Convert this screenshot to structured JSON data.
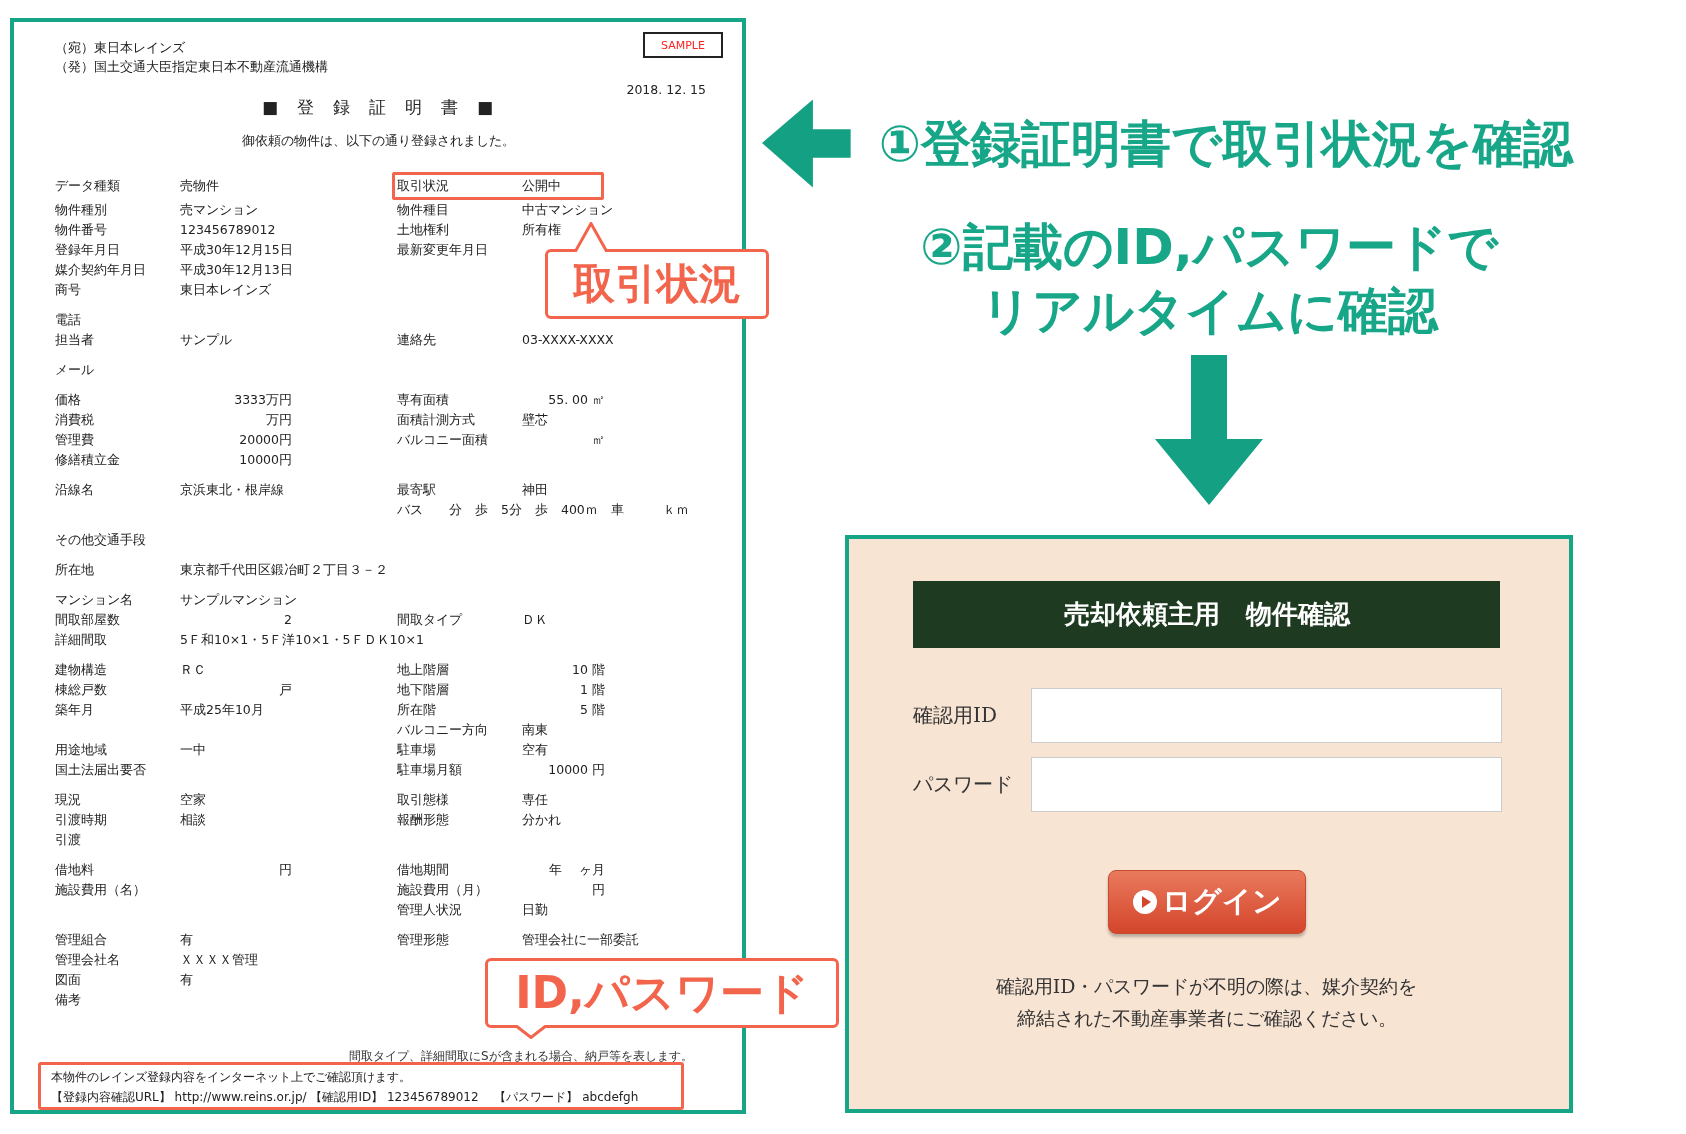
{
  "certificate": {
    "addressee": "（宛）東日本レインズ",
    "sender": "（発）国土交通大臣指定東日本不動産流通機構",
    "stamp": "SAMPLE",
    "date": "2018. 12. 15",
    "title": "■　登　録　証　明　書　■",
    "intro": "御依頼の物件は、以下の通り登録されました。",
    "groups": [
      [
        {
          "left": {
            "label": "データ種類",
            "value": "売物件"
          },
          "right": {
            "label": "取引状況",
            "value": "公開中"
          }
        },
        {
          "left": {
            "label": "物件種別",
            "value": "売マンション"
          },
          "right": {
            "label": "物件種目",
            "value": "中古マンション"
          }
        },
        {
          "left": {
            "label": "物件番号",
            "value": "123456789012"
          },
          "right": {
            "label": "土地権利",
            "value": "所有権"
          }
        },
        {
          "left": {
            "label": "登録年月日",
            "value": "平成30年12月15日"
          },
          "right": {
            "label": "最新変更年月日"
          }
        },
        {
          "left": {
            "label": "媒介契約年月日",
            "value": "平成30年12月13日"
          }
        },
        {
          "left": {
            "label": "商号",
            "value": "東日本レインズ"
          }
        }
      ],
      [
        {
          "left": {
            "label": "電話"
          }
        },
        {
          "left": {
            "label": "担当者",
            "value": "サンプル"
          },
          "right": {
            "label": "連絡先",
            "value": "03-XXXX-XXXX"
          }
        }
      ],
      [
        {
          "left": {
            "label": "メール"
          }
        }
      ],
      [
        {
          "left": {
            "label": "価格",
            "value": "3333万円",
            "kind": "amount"
          },
          "right": {
            "label": "専有面積",
            "value": "55. 00 ㎡",
            "kind": "amount"
          }
        },
        {
          "left": {
            "label": "消費税",
            "value": "万円",
            "kind": "amount"
          },
          "right": {
            "label": "面積計測方式",
            "value": "壁芯"
          }
        },
        {
          "left": {
            "label": "管理費",
            "value": "20000円",
            "kind": "amount"
          },
          "right": {
            "label": "バルコニー面積",
            "value": "㎡",
            "kind": "amount"
          }
        },
        {
          "left": {
            "label": "修繕積立金",
            "value": "10000円",
            "kind": "amount"
          }
        }
      ],
      [
        {
          "left": {
            "label": "沿線名",
            "value": "京浜東北・根岸線"
          },
          "right": {
            "label": "最寄駅",
            "value": "神田"
          }
        },
        {
          "right": {
            "value": "バス　　分　歩　5分　歩　400ｍ　車　　　ｋｍ"
          }
        }
      ],
      [
        {
          "left": {
            "label": "その他交通手段"
          }
        }
      ],
      [
        {
          "left": {
            "label": "所在地",
            "value": "東京都千代田区鍛冶町２丁目３－２"
          }
        }
      ],
      [
        {
          "left": {
            "label": "マンション名",
            "value": "サンプルマンション"
          }
        },
        {
          "left": {
            "label": "間取部屋数",
            "value": "2",
            "kind": "amount"
          },
          "right": {
            "label": "間取タイプ",
            "value": "ＤＫ"
          }
        },
        {
          "left": {
            "label": "詳細間取",
            "value": "5Ｆ和10×1・5Ｆ洋10×1・5ＦＤＫ10×1"
          }
        }
      ],
      [
        {
          "left": {
            "label": "建物構造",
            "value": "ＲＣ"
          },
          "right": {
            "label": "地上階層",
            "value": "10 階",
            "kind": "amount"
          }
        },
        {
          "left": {
            "label": "棟総戸数",
            "value": "戸",
            "kind": "amount"
          },
          "right": {
            "label": "地下階層",
            "value": "1 階",
            "kind": "amount"
          }
        },
        {
          "left": {
            "label": "築年月",
            "value": "平成25年10月"
          },
          "right": {
            "label": "所在階",
            "value": "5 階",
            "kind": "amount"
          }
        },
        {
          "right": {
            "label": "バルコニー方向",
            "value": "南東"
          }
        },
        {
          "left": {
            "label": "用途地域",
            "value": "一中"
          },
          "right": {
            "label": "駐車場",
            "value": "空有"
          }
        },
        {
          "left": {
            "label": "国土法届出要否"
          },
          "right": {
            "label": "駐車場月額",
            "value": "10000 円",
            "kind": "amount"
          }
        }
      ],
      [
        {
          "left": {
            "label": "現況",
            "value": "空家"
          },
          "right": {
            "label": "取引態様",
            "value": "専任"
          }
        },
        {
          "left": {
            "label": "引渡時期",
            "value": "相談"
          },
          "right": {
            "label": "報酬形態",
            "value": "分かれ"
          }
        },
        {
          "left": {
            "label": "引渡"
          }
        }
      ],
      [
        {
          "left": {
            "label": "借地料",
            "value": "円",
            "kind": "amount"
          },
          "right": {
            "label": "借地期間",
            "value": "年　 ヶ月",
            "kind": "amount"
          }
        },
        {
          "left": {
            "label": "施設費用（名）"
          },
          "right": {
            "label": "施設費用（月）",
            "value": "円",
            "kind": "amount"
          }
        },
        {
          "right": {
            "label": "管理人状況",
            "value": "日勤"
          }
        }
      ],
      [
        {
          "left": {
            "label": "管理組合",
            "value": "有"
          },
          "right": {
            "label": "管理形態",
            "value": "管理会社に一部委託"
          }
        },
        {
          "left": {
            "label": "管理会社名",
            "value": "ＸＸＸＸ管理"
          }
        },
        {
          "left": {
            "label": "図面",
            "value": "有"
          }
        },
        {
          "left": {
            "label": "備考"
          }
        }
      ]
    ],
    "note": "間取タイプ、詳細間取にSが含まれる場合、納戸等を表します。",
    "footer": [
      "本物件のレインズ登録内容をインターネット上でご確認頂けます。",
      "【登録内容確認URL】 http://www.reins.or.jp/ 【確認用ID】 123456789012 　【パスワード】 abcdefgh"
    ]
  },
  "callouts": [
    "取引状況",
    "ID,パスワード"
  ],
  "steps": [
    {
      "lines": [
        "①登録証明書で取引状況を確認"
      ]
    },
    {
      "lines": [
        "②記載のID,パスワードで",
        "リアルタイムに確認"
      ]
    }
  ],
  "login": {
    "title": "売却依頼主用　物件確認",
    "fields": [
      {
        "label": "確認用ID"
      },
      {
        "label": "パスワード"
      }
    ],
    "button": "ログイン",
    "note": [
      "確認用ID・パスワードが不明の際は、媒介契約を",
      "締結された不動産事業者にご確認ください。"
    ]
  }
}
